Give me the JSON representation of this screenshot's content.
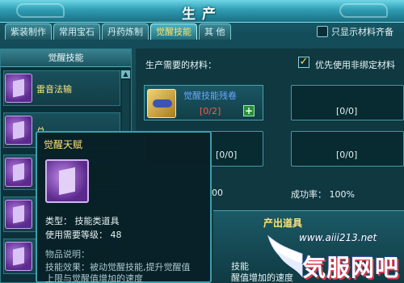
{
  "window": {
    "title": "生产",
    "tabs": [
      {
        "label": "紫装制作",
        "active": false
      },
      {
        "label": "常用宝石",
        "active": false
      },
      {
        "label": "丹药炼制",
        "active": false
      },
      {
        "label": "觉醒技能",
        "active": true
      },
      {
        "label": "其 他",
        "active": false
      }
    ],
    "only_show_option": "只显示材料齐备"
  },
  "left_panel": {
    "header": "觉醒技能",
    "skills": [
      {
        "name": "雷音法输"
      },
      {
        "name": "总"
      },
      {
        "name": ""
      },
      {
        "name": ""
      },
      {
        "name": ""
      }
    ]
  },
  "tooltip": {
    "title": "觉醒天赋",
    "type_line": "类型：  技能类道具",
    "level_line": "使用需要等级：  48",
    "desc_header": "物品说明：",
    "desc_line1": "技能效果：被动觉醒技能,提升觉醒值",
    "desc_line2": "上限与觉醒值增加的速度"
  },
  "production": {
    "materials_label": "生产需要的材料：",
    "prefer_unbound": "优先使用非绑定材料",
    "prefer_unbound_checked": true,
    "material": {
      "name": "觉醒技能残卷",
      "count": "[0/2]"
    },
    "slot_counts": [
      "[0/0]",
      "[0/0]",
      "[0/0]"
    ],
    "cost_value": "00",
    "success_rate_label": "成功率：  100%",
    "output": {
      "header": "产出道具",
      "line1": "技能",
      "line2": "醒值增加的速度"
    }
  },
  "watermark": {
    "url": "www.aiii213.net",
    "text": "気服网吧"
  },
  "colors": {
    "accent_gold": "#ffe27a",
    "material_name": "#6aa9ff",
    "count_red": "#ff5a4a"
  }
}
